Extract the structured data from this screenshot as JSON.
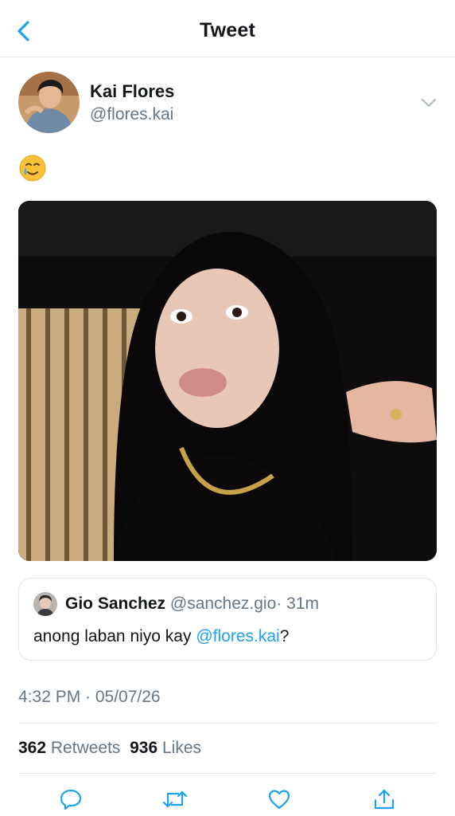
{
  "header": {
    "title": "Tweet",
    "back_icon": "chevron-left-icon",
    "accent": "#1da1f2"
  },
  "tweet": {
    "author_name": "Kai Flores",
    "author_handle": "@flores.kai",
    "body_emoji": "🥲",
    "timestamp": "4:32 PM · 05/07/26",
    "retweets": "362",
    "retweets_label": "Retweets",
    "likes": "936",
    "likes_label": "Likes"
  },
  "quoted": {
    "author_name": "Gio Sanchez",
    "author_handle": "@sanchez.gio",
    "time_ago": "· 31m",
    "text_prefix": "anong laban niyo kay ",
    "mention": "@flores.kai",
    "text_suffix": "?"
  },
  "actions": [
    "reply-icon",
    "retweet-icon",
    "like-icon",
    "share-icon"
  ],
  "colors": {
    "muted": "#657786",
    "link": "#1da1f2",
    "border": "#e1e8ed"
  }
}
